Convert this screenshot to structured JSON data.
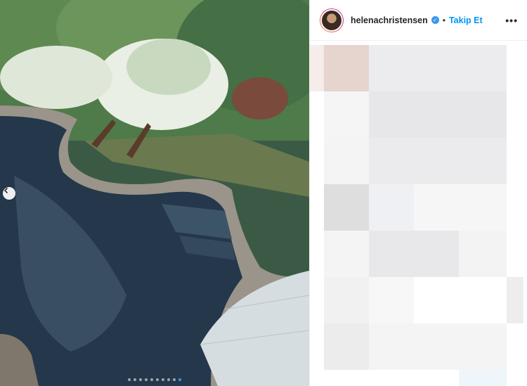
{
  "post": {
    "username": "helenachristensen",
    "separator": "•",
    "follow_label": "Takip Et",
    "more_label": "•••",
    "verified": true,
    "carousel": {
      "total": 10,
      "active_index": 9
    }
  },
  "icons": {
    "verified": "verified-badge-icon",
    "prev": "chevron-left-icon",
    "more": "more-options-icon"
  },
  "colors": {
    "accent": "#0095f6",
    "border": "#efefef",
    "text": "#262626"
  }
}
